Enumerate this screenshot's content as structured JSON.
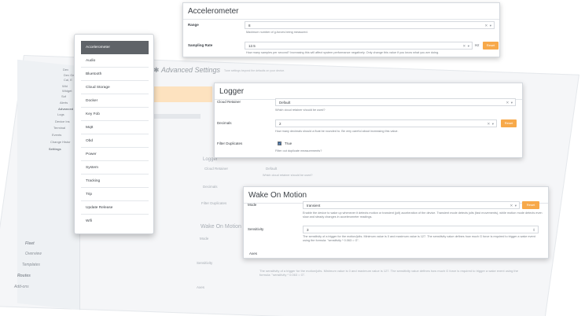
{
  "background": {
    "page_title": "Advanced Settings",
    "page_subtitle": "Tune settings beyond the defaults on your device.",
    "sidebar_items": [
      "Dev",
      "Dev Gen",
      "Cal, E",
      "Wid",
      "Widget",
      "Sof",
      "Alerts",
      "Advanced",
      "Logs",
      "Device Ins",
      "Terminal",
      "Events",
      "Change Histor",
      "Settings"
    ],
    "bottom_list": [
      "Fleet",
      "Overview",
      "Templates",
      "Routes",
      "Add-ons"
    ],
    "logger_label": "Logger",
    "cloud_retainer_label": "Cloud Retainer",
    "cloud_retainer_value": "Default",
    "cloud_retainer_hint": "Which cloud retainer should be used?",
    "decimals_label": "Decimals",
    "filter_duplicates_label": "Filter Duplicates",
    "wake_on_motion_label": "Wake On Motion",
    "mode_label": "Mode",
    "sensitivity_label": "Sensitivity",
    "axes_label": "Axes",
    "sensitivity_hint": "The sensitivity of a trigger for the motion/jolts. Minimum value is 0 and maximum value is 127. The sensitivity value defines how much G force is required to trigger a wake event using the formula: \"sensitivity * 0.063 = G\"."
  },
  "menu": {
    "items": [
      "Accelerometer",
      "Audio",
      "Bluetooth",
      "Cloud Storage",
      "Docker",
      "Key Fob",
      "Mqtt",
      "Obd",
      "Power",
      "System",
      "Tracking",
      "Trip",
      "Update Release",
      "Wifi"
    ],
    "active_index": 0
  },
  "accelerometer": {
    "title": "Accelerometer",
    "range_label": "Range",
    "range_value": "8",
    "range_hint": "Maximum number of g-forces being measured.",
    "rate_label": "Sampling Rate",
    "rate_value": "12.5",
    "rate_unit": "Hz",
    "rate_hint": "How many samples per second? Increasing this will affect system performance negatively. Only change this value if you know what you are doing.",
    "reset_label": "Reset"
  },
  "logger": {
    "title": "Logger",
    "cloud_retainer_label": "Cloud Retainer",
    "cloud_retainer_value": "Default",
    "cloud_retainer_hint": "Which cloud retainer should be used?",
    "decimals_label": "Decimals",
    "decimals_value": "2",
    "decimals_hint": "How many decimals should a float be rounded to. Be very careful about increasing this value.",
    "filter_label": "Filter Duplicates",
    "filter_value": "True",
    "filter_hint": "Filter out duplicate measurements?",
    "reset_label": "Reset"
  },
  "wake_on_motion": {
    "title": "Wake On Motion",
    "mode_label": "Mode",
    "mode_value": "transient",
    "mode_hint": "Enable the device to wake up whenever it detects motion or transient (jolt) acceleration of the device. Transient mode detects jolts (fast movements), while motion mode detects even slow and steady changes in accelerometer readings.",
    "sensitivity_label": "Sensitivity",
    "sensitivity_value": "3",
    "sensitivity_hint": "The sensitivity of a trigger for the motion/jolts. Minimum value is 0 and maximum value is 127. The sensitivity value defines how much G force is required to trigger a wake event using the formula: \"sensitivity * 0.063 = G\".",
    "axes_label": "Axes",
    "reset_label": "Reset"
  }
}
